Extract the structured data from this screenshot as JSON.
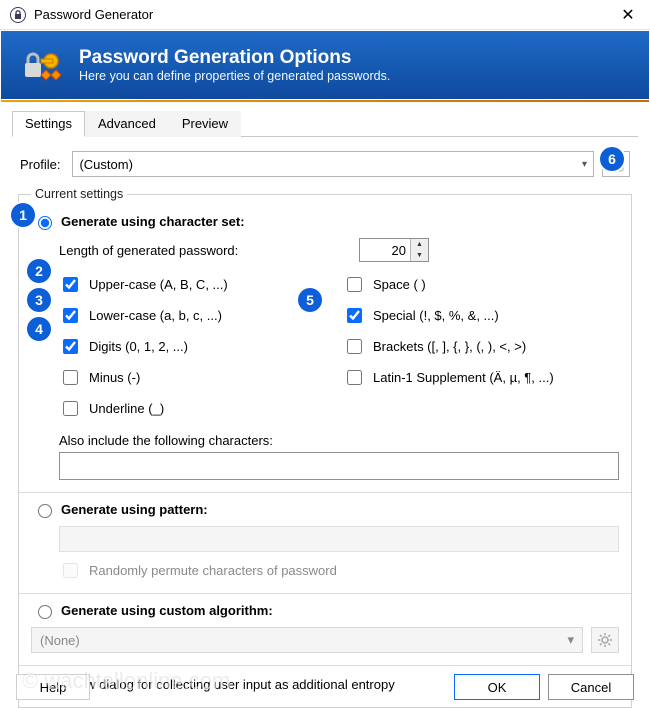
{
  "titlebar": {
    "title": "Password Generator"
  },
  "banner": {
    "heading": "Password Generation Options",
    "sub": "Here you can define properties of generated passwords."
  },
  "tabs": {
    "settings": "Settings",
    "advanced": "Advanced",
    "preview": "Preview"
  },
  "profile": {
    "label": "Profile:",
    "value": "(Custom)"
  },
  "fieldset_legend": "Current settings",
  "modes": {
    "charset": "Generate using character set:",
    "pattern": "Generate using pattern:",
    "custom": "Generate using custom algorithm:"
  },
  "length": {
    "label": "Length of generated password:",
    "value": "20"
  },
  "checks": {
    "upper": "Upper-case (A, B, C, ...)",
    "lower": "Lower-case (a, b, c, ...)",
    "digits": "Digits (0, 1, 2, ...)",
    "minus": "Minus (-)",
    "underline": "Underline (_)",
    "space": "Space ( )",
    "special": "Special (!, $, %, &, ...)",
    "brackets": "Brackets ([, ], {, }, (, ), <, >)",
    "latin1": "Latin-1 Supplement (Ä, µ, ¶, ...)"
  },
  "also_label": "Also include the following characters:",
  "permute_label": "Randomly permute characters of password",
  "custom_select": "(None)",
  "entropy_label": "Show dialog for collecting user input as additional entropy",
  "buttons": {
    "help": "Help",
    "ok": "OK",
    "cancel": "Cancel"
  },
  "watermark": "© wachtellonline.com",
  "annotations": {
    "a1": "1",
    "a2": "2",
    "a3": "3",
    "a4": "4",
    "a5": "5",
    "a6": "6"
  }
}
